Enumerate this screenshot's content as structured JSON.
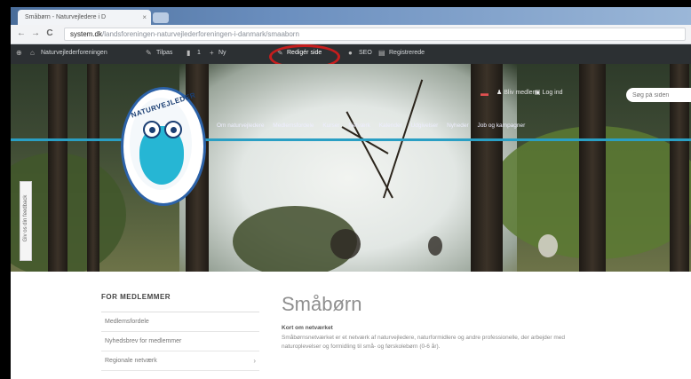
{
  "browser": {
    "tab_title": "Småbørn - Naturvejledere i D",
    "tab_close": "×",
    "url_domain": "system.dk",
    "url_path": "/landsforeningen-naturvejlederforeningen-i-danmark/smaaborn",
    "back": "←",
    "forward": "→",
    "reload": "C"
  },
  "adminbar": {
    "site": "Naturvejlederforeningen",
    "customize": "Tilpas",
    "comments": "1",
    "new": "Ny",
    "edit": "Redigér side",
    "seo": "SEO",
    "register": "Registrerede"
  },
  "header": {
    "members_link": "Bliv medlem",
    "login_link": "Log ind",
    "search_placeholder": "Søg på siden",
    "nav": [
      "Om naturvejledere",
      "Medlemsfordele",
      "Kurser",
      "Netværk",
      "Kalender",
      "Udgivelser",
      "Nyheder",
      "Job og kampagner"
    ],
    "logo_text": "NATURVEJLEDER"
  },
  "sidetab": {
    "label": "Giv os din feedback"
  },
  "sidebar": {
    "title": "FOR MEDLEMMER",
    "items": [
      {
        "label": "Medlemsfordele"
      },
      {
        "label": "Nyhedsbrev for medlemmer"
      },
      {
        "label": "Regionale netværk",
        "chevron": "›"
      }
    ]
  },
  "main": {
    "title": "Småbørn",
    "subhead": "Kort om netværket",
    "lines": [
      "Småbørnsnetværket er et netværk af naturvejledere, naturformidlere og andre professionelle, der arbejder med",
      "naturoplevelser og formidling til små- og førskolebørn (0-6 år)."
    ]
  }
}
